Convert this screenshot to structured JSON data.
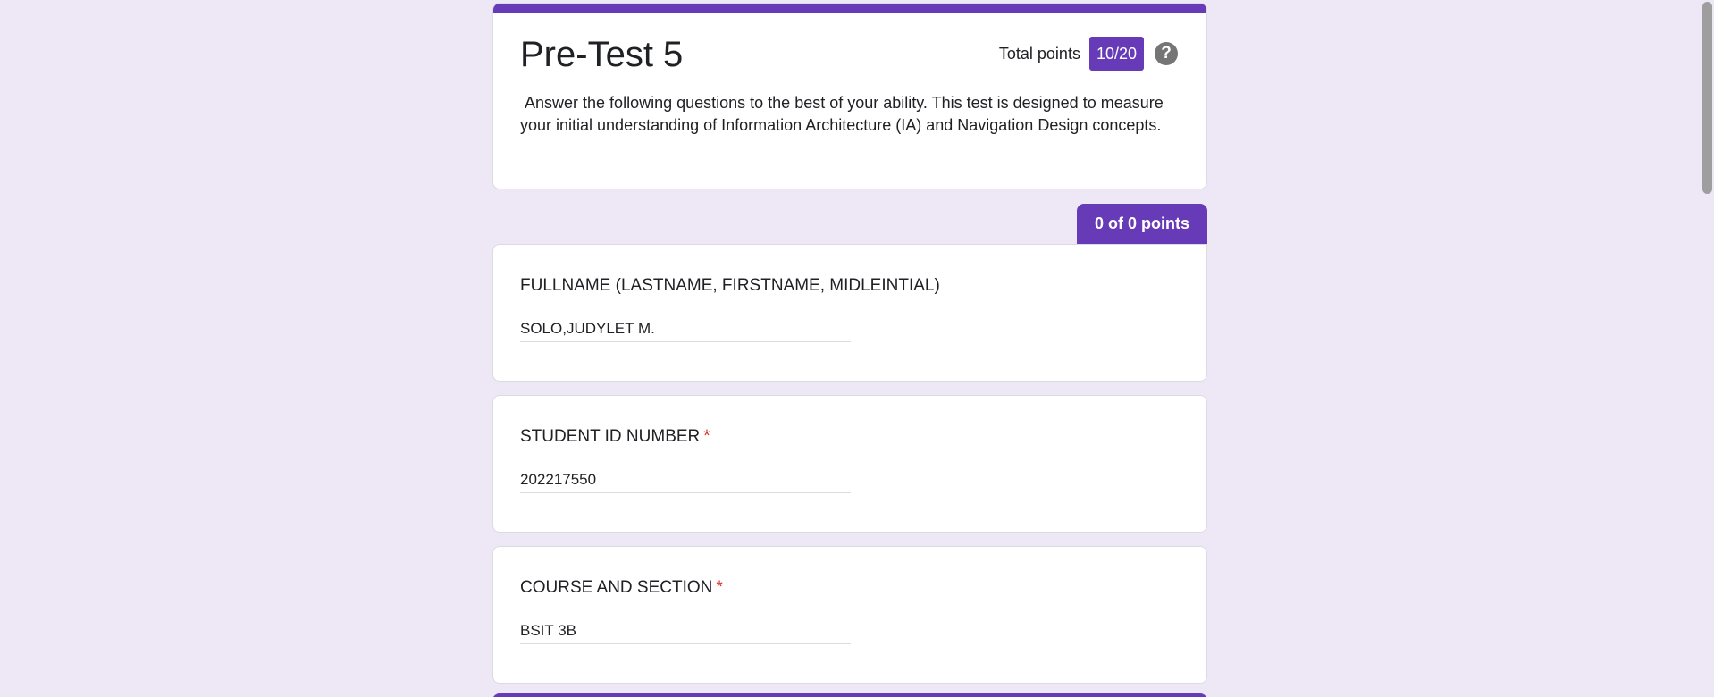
{
  "form": {
    "title": "Pre-Test 5",
    "total_points_label": "Total points",
    "score": "10/20",
    "help_icon": "?",
    "description": " Answer the following questions to the best of your ability. This test is designed to measure your initial understanding of Information Architecture (IA) and Navigation Design concepts."
  },
  "section": {
    "points_label": "0 of 0 points"
  },
  "questions": [
    {
      "title": "FULLNAME (LASTNAME, FIRSTNAME, MIDLEINTIAL)",
      "required": false,
      "answer": "SOLO,JUDYLET M."
    },
    {
      "title": "STUDENT ID NUMBER",
      "required": true,
      "required_mark": "*",
      "answer": "202217550"
    },
    {
      "title": "COURSE AND SECTION",
      "required": true,
      "required_mark": "*",
      "answer": "BSIT 3B"
    }
  ],
  "colors": {
    "accent": "#673ab7",
    "background": "#ede7f6",
    "required": "#d93025"
  }
}
